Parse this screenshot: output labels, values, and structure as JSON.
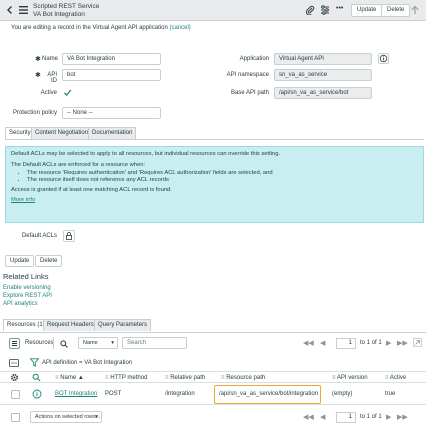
{
  "header": {
    "title_line1": "Scripted REST Service",
    "title_line2": "VA Bot Integration",
    "update_button": "Update",
    "delete_button": "Delete",
    "more_label": "•••"
  },
  "notice": {
    "text": "You are editing a record in the Virtual Agent API application",
    "cancel": "(cancel)"
  },
  "form": {
    "name_label": "Name",
    "name_value": "VA Bot Integration",
    "api_id_label": "API ID",
    "api_id_value": "bot",
    "active_label": "Active",
    "protection_label": "Protection policy",
    "protection_value": "-- None --",
    "application_label": "Application",
    "application_value": "Virtual Agent API",
    "namespace_label": "API namespace",
    "namespace_value": "sn_va_as_service",
    "base_path_label": "Base API path",
    "base_path_value": "/api/sn_va_as_service/bot"
  },
  "form_tabs": [
    "Security",
    "Content Negotiation",
    "Documentation"
  ],
  "security_info": {
    "p1": "Default ACLs may be selected to apply to all resources, but individual resources can override this setting.",
    "p2": "The Default ACLs are enforced for a resource when:",
    "bullet1": "The resource 'Requires authentication' and 'Requires ACL authorization' fields are selected, and",
    "bullet2": "The resource itself does not reference any ACL records",
    "p3": "Access is granted if at least one matching ACL record is found.",
    "more_info": "More info"
  },
  "default_acls_label": "Default ACLs",
  "bottom_buttons": {
    "update": "Update",
    "delete": "Delete"
  },
  "related_links": {
    "heading": "Related Links",
    "links": [
      "Enable versioning",
      "Explore REST API",
      "API analytics"
    ]
  },
  "related_tabs": [
    "Resources (1)",
    "Request Headers",
    "Query Parameters"
  ],
  "list": {
    "title": "Resources",
    "search_field": "Name",
    "search_placeholder": "Search",
    "page_value": "1",
    "page_total": "to 1 of 1",
    "filter_text": "API definition = VA Bot Integration",
    "columns": [
      "Name ▲",
      "HTTP method",
      "Relative path",
      "Resource path",
      "API version",
      "Active"
    ],
    "rows": [
      {
        "name": "BOT Integration",
        "method": "POST",
        "relative_path": "/integration",
        "resource_path": "/api/sn_va_as_service/bot/integration",
        "api_version": "(empty)",
        "active": "true"
      }
    ],
    "actions_placeholder": "Actions on selected rows...",
    "footer_page_value": "1",
    "footer_page_total": "to 1 of 1"
  },
  "colors": {
    "accent": "#1f8476",
    "info_bg": "#c8eef2",
    "highlight": "#f0a830",
    "warning": "#f59b1f"
  }
}
